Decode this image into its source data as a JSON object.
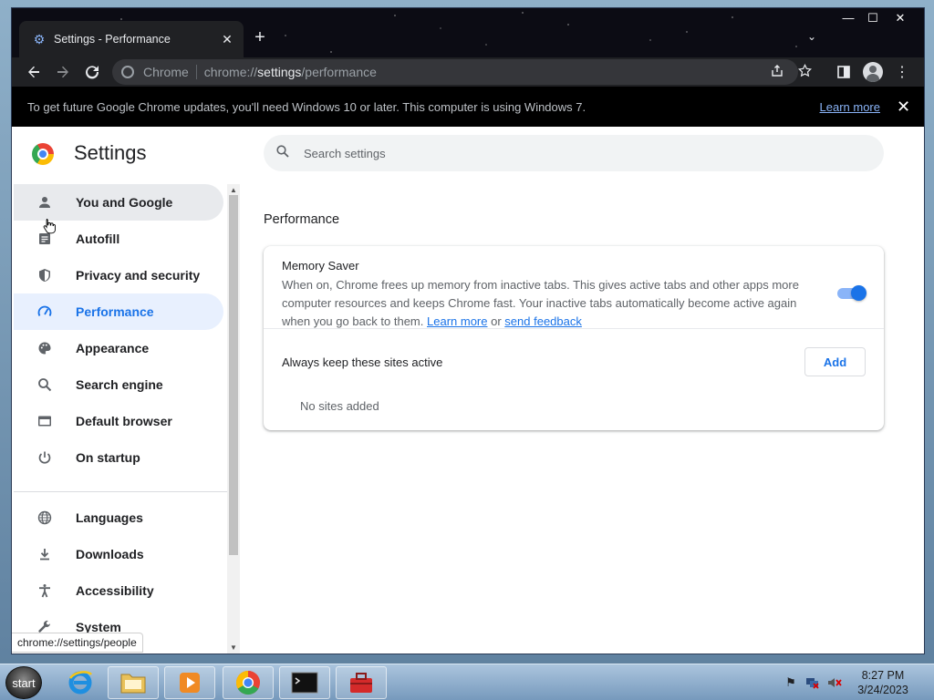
{
  "browser": {
    "tab_title": "Settings - Performance",
    "tab_close": "✕",
    "new_tab": "+",
    "tab_search": "⌄",
    "omnibox": {
      "site_label": "Chrome",
      "url_prefix": "chrome://",
      "url_bold": "settings",
      "url_suffix": "/performance"
    },
    "window_controls": [
      "—",
      "☐",
      "✕"
    ]
  },
  "infobar": {
    "message": "To get future Google Chrome updates, you'll need Windows 10 or later. This computer is using Windows 7.",
    "link": "Learn more",
    "close": "✕"
  },
  "settings": {
    "title": "Settings",
    "search_placeholder": "Search settings",
    "nav": [
      {
        "label": "You and Google",
        "icon": "person-icon",
        "state": "hover"
      },
      {
        "label": "Autofill",
        "icon": "autofill-icon",
        "state": ""
      },
      {
        "label": "Privacy and security",
        "icon": "shield-icon",
        "state": ""
      },
      {
        "label": "Performance",
        "icon": "speedometer-icon",
        "state": "active"
      },
      {
        "label": "Appearance",
        "icon": "palette-icon",
        "state": ""
      },
      {
        "label": "Search engine",
        "icon": "search-icon",
        "state": ""
      },
      {
        "label": "Default browser",
        "icon": "browser-window-icon",
        "state": ""
      },
      {
        "label": "On startup",
        "icon": "power-icon",
        "state": ""
      },
      {
        "label": "Languages",
        "icon": "globe-icon",
        "state": ""
      },
      {
        "label": "Downloads",
        "icon": "download-icon",
        "state": ""
      },
      {
        "label": "Accessibility",
        "icon": "accessibility-icon",
        "state": ""
      },
      {
        "label": "System",
        "icon": "wrench-icon",
        "state": ""
      }
    ],
    "section_title": "Performance",
    "memory_saver": {
      "title": "Memory Saver",
      "description": "When on, Chrome frees up memory from inactive tabs. This gives active tabs and other apps more computer resources and keeps Chrome fast. Your inactive tabs automatically become active again when you go back to them.",
      "learn_more": "Learn more",
      "or": "or",
      "send_feedback": "send feedback",
      "enabled": true
    },
    "always_active": {
      "label": "Always keep these sites active",
      "add_button": "Add",
      "empty_text": "No sites added"
    },
    "status_url": "chrome://settings/people"
  },
  "taskbar": {
    "start_label": "start",
    "time": "8:27 PM",
    "date": "3/24/2023"
  },
  "colors": {
    "accent": "#1a73e8",
    "active_nav_bg": "#e8f0fe",
    "titlebar": "#0c0c14"
  }
}
